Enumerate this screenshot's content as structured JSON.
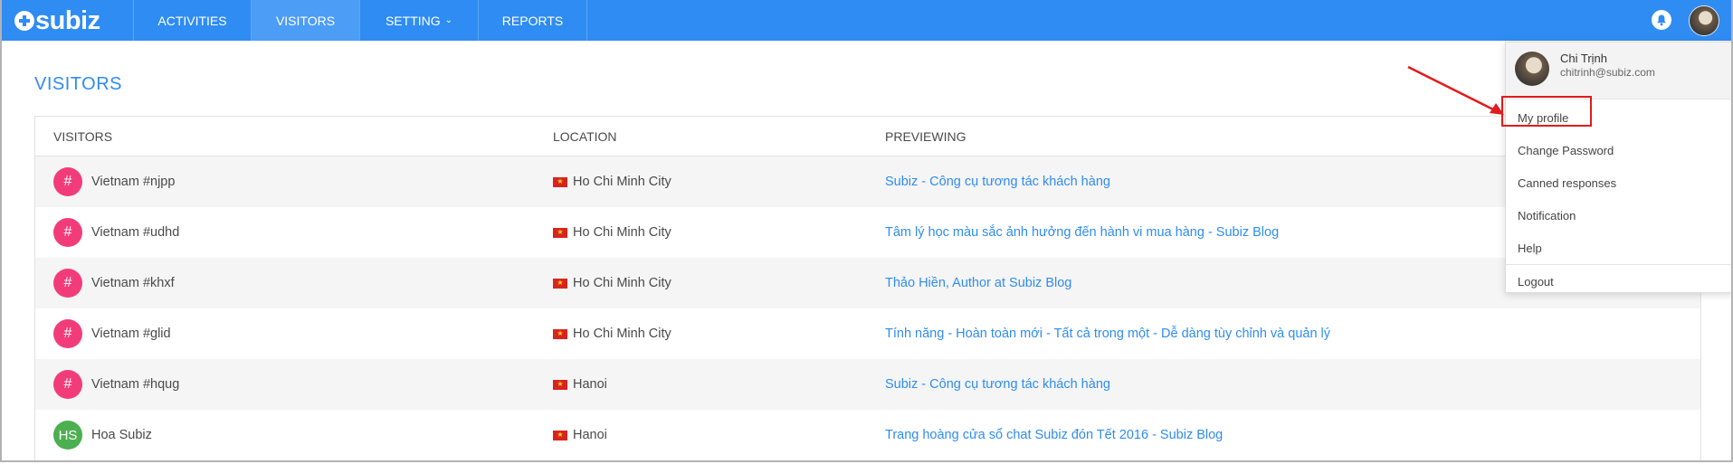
{
  "brand": {
    "name": "subiz",
    "accent": "#2f8cf2"
  },
  "nav": {
    "items": [
      {
        "label": "ACTIVITIES",
        "active": false
      },
      {
        "label": "VISITORS",
        "active": true
      },
      {
        "label": "SETTING",
        "active": false,
        "has_caret": true
      },
      {
        "label": "REPORTS",
        "active": false
      }
    ]
  },
  "icons": {
    "bell": "bell-icon",
    "caret": "chevron-down-icon"
  },
  "page": {
    "title": "VISITORS"
  },
  "table": {
    "headers": [
      "VISITORS",
      "LOCATION",
      "PREVIEWING"
    ],
    "rows": [
      {
        "avatar": "#",
        "name": "Vietnam #njpp",
        "location": "Ho Chi Minh City",
        "preview": "Subiz - Công cụ tương tác khách hàng"
      },
      {
        "avatar": "#",
        "name": "Vietnam #udhd",
        "location": "Ho Chi Minh City",
        "preview": "Tâm lý học màu sắc ảnh hưởng đến hành vi mua hàng - Subiz Blog"
      },
      {
        "avatar": "#",
        "name": "Vietnam #khxf",
        "location": "Ho Chi Minh City",
        "preview": "Thảo Hiền, Author at Subiz Blog"
      },
      {
        "avatar": "#",
        "name": "Vietnam #glid",
        "location": "Ho Chi Minh City",
        "preview": "Tính năng - Hoàn toàn mới - Tất cả trong một - Dễ dàng tùy chỉnh và quản lý"
      },
      {
        "avatar": "#",
        "name": "Vietnam #hqug",
        "location": "Hanoi",
        "preview": "Subiz - Công cụ tương tác khách hàng"
      },
      {
        "avatar": "HS",
        "name": "Hoa Subiz",
        "location": "Hanoi",
        "preview": "Trang hoàng cửa sổ chat Subiz đón Tết 2016 - Subiz Blog"
      }
    ]
  },
  "profile_menu": {
    "name": "Chi Trịnh",
    "email": "chitrinh@subiz.com",
    "items": [
      "My profile",
      "Change Password",
      "Canned responses",
      "Notification",
      "Help"
    ],
    "logout": "Logout"
  }
}
